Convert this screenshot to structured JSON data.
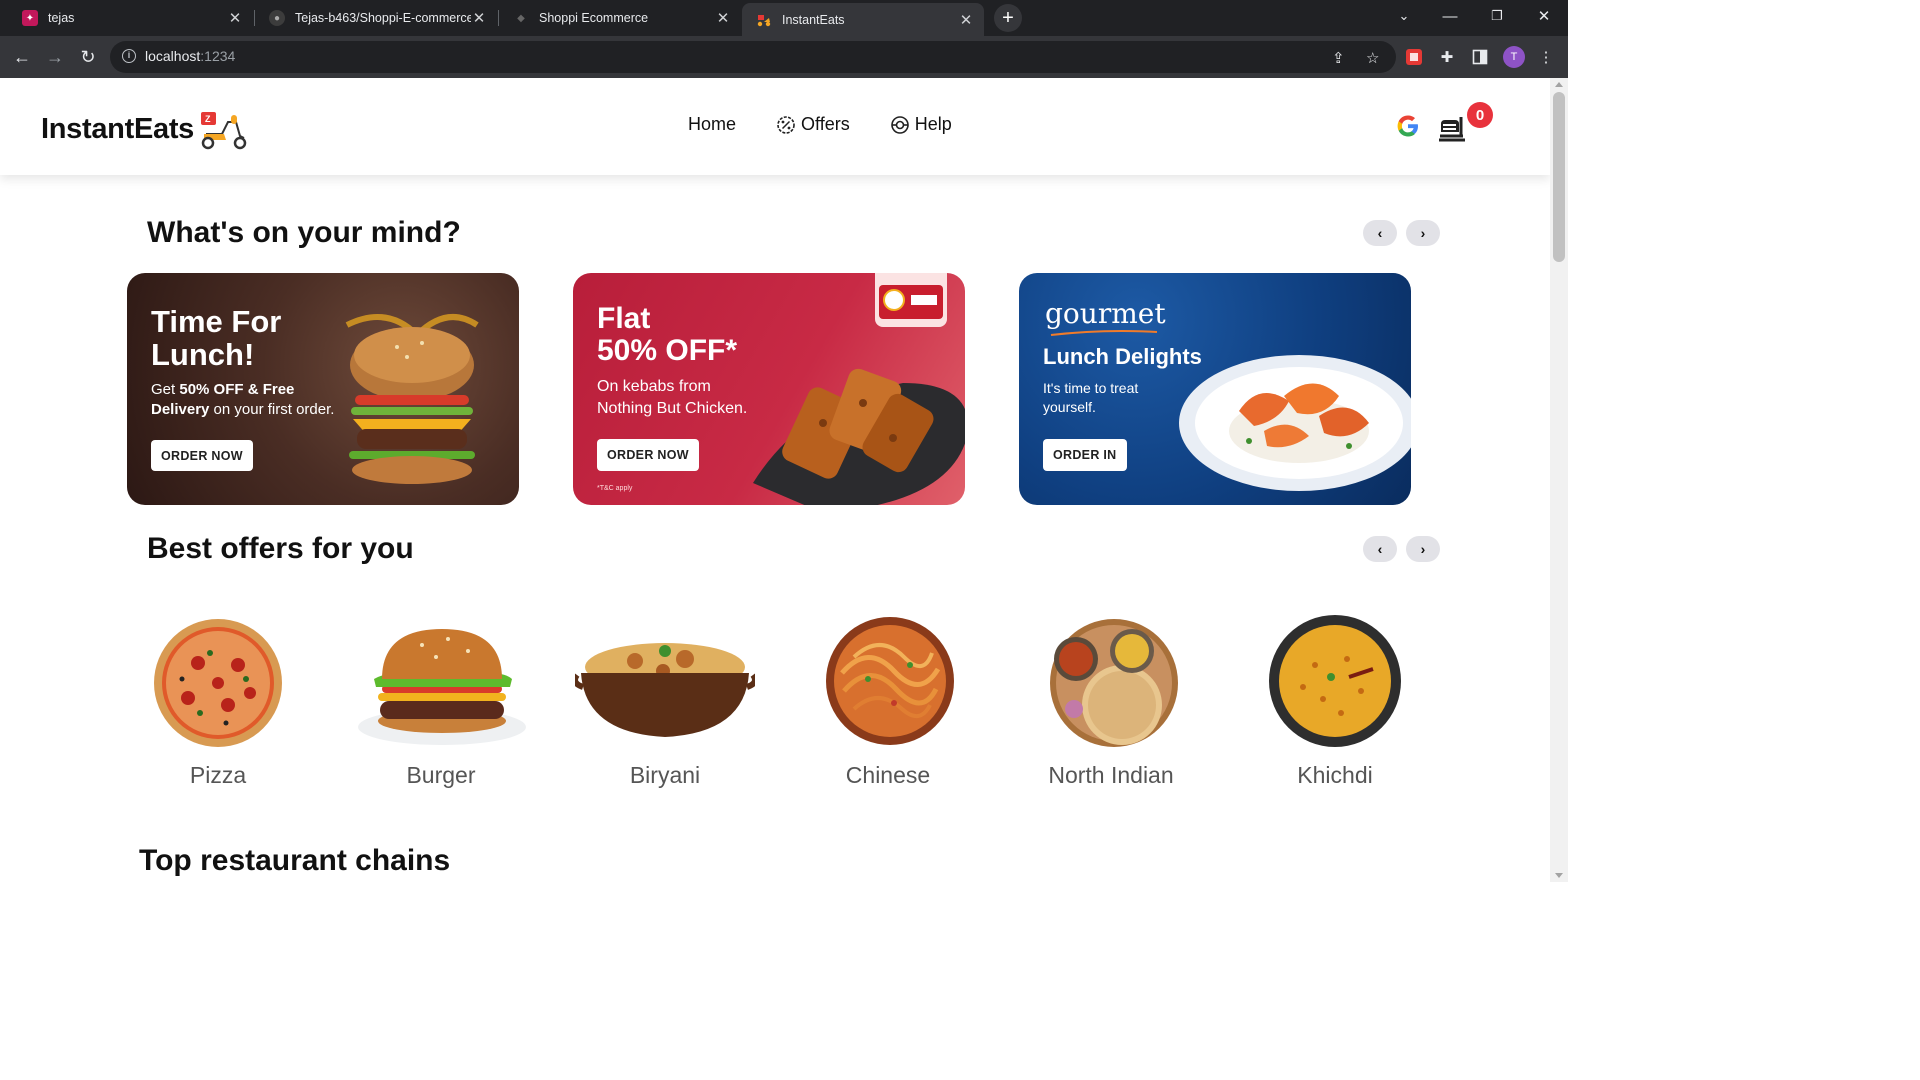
{
  "browser": {
    "tabs": [
      {
        "title": "tejas",
        "active": false
      },
      {
        "title": "Tejas-b463/Shoppi-E-commerce",
        "active": false
      },
      {
        "title": "Shoppi Ecommerce",
        "active": false
      },
      {
        "title": "InstantEats",
        "active": true
      }
    ],
    "url_host": "localhost",
    "url_port": ":1234",
    "profile_initial": "T"
  },
  "header": {
    "logo_text": "InstantEats",
    "nav": [
      {
        "label": "Home",
        "icon": ""
      },
      {
        "label": "Offers",
        "icon": "percent-badge-icon"
      },
      {
        "label": "Help",
        "icon": "lifebuoy-icon"
      }
    ],
    "cart_count": "0"
  },
  "mind_section": {
    "title": "What's on your mind?",
    "banners": [
      {
        "headline_1": "Time For",
        "headline_2": "Lunch!",
        "sub_prefix": "Get ",
        "sub_bold": "50% OFF & Free",
        "sub_bold_2": "Delivery",
        "sub_rest": " on your first order.",
        "cta": "ORDER NOW"
      },
      {
        "headline_1": "Flat",
        "headline_2": "50% OFF*",
        "sub_1": "On kebabs from",
        "sub_2": "Nothing But Chicken.",
        "cta": "ORDER NOW",
        "terms": "*T&C apply"
      },
      {
        "brand": "gourmet",
        "headline": "Lunch Delights",
        "sub_1": "It's time to treat",
        "sub_2": "yourself.",
        "cta": "ORDER IN"
      }
    ]
  },
  "offers_section": {
    "title": "Best offers for you",
    "categories": [
      "Pizza",
      "Burger",
      "Biryani",
      "Chinese",
      "North Indian",
      "Khichdi"
    ]
  },
  "chains_section": {
    "title": "Top restaurant chains"
  }
}
